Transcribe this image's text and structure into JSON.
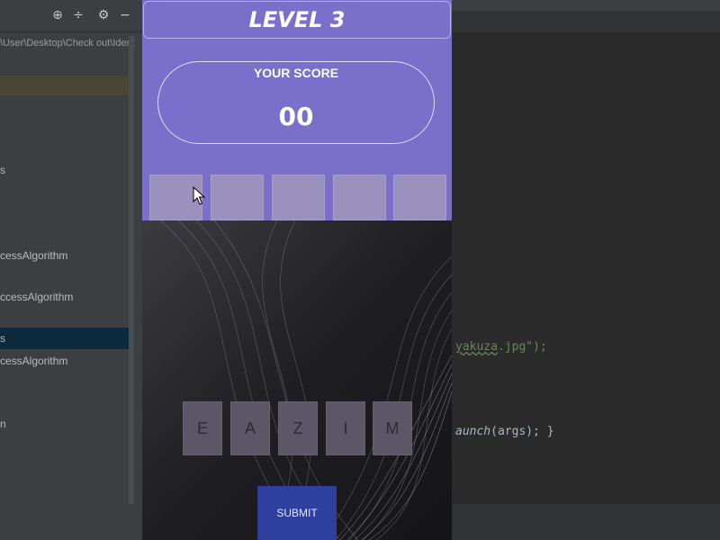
{
  "ide": {
    "path_fragment": "\\User\\Desktop\\Check out\\Identi",
    "tree_items": [
      "s",
      "cessAlgorithm",
      "ccessAlgorithm",
      "s",
      "cessAlgorithm",
      "n"
    ],
    "code": {
      "line1_string": "yakuza",
      "line1_rest": ".jpg\");",
      "line2_call": "aunch",
      "line2_rest": "(args); }"
    }
  },
  "game": {
    "level_title": "LEVEL 3",
    "score_label": "YOUR SCORE",
    "score_value": "00",
    "answer_slots": [
      "",
      "",
      "",
      "",
      ""
    ],
    "letters": [
      "E",
      "A",
      "Z",
      "I",
      "M"
    ],
    "submit_label": "SUBMIT"
  },
  "colors": {
    "game_accent": "#7b6fcc",
    "submit_button": "#2f3f9e",
    "ide_background": "#2b2b2b"
  }
}
